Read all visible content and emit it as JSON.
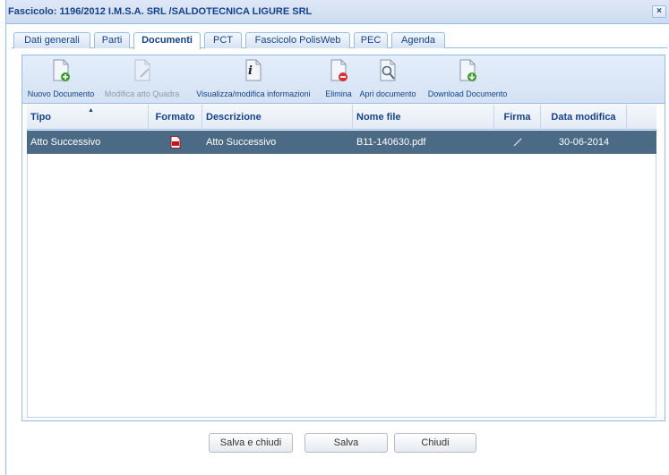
{
  "window": {
    "title": "Fascicolo: 1196/2012 I.M.S.A. SRL /SALDOTECNICA LIGURE SRL",
    "close_symbol": "×"
  },
  "tabs": [
    {
      "label": "Dati generali",
      "active": false
    },
    {
      "label": "Parti",
      "active": false
    },
    {
      "label": "Documenti",
      "active": true
    },
    {
      "label": "PCT",
      "active": false
    },
    {
      "label": "Fascicolo PolisWeb",
      "active": false
    },
    {
      "label": "PEC",
      "active": false
    },
    {
      "label": "Agenda",
      "active": false
    }
  ],
  "toolbar": {
    "buttons": [
      {
        "label": "Nuovo Documento",
        "icon": "new-document-icon",
        "enabled": true
      },
      {
        "label": "Modifica atto Quadra",
        "icon": "edit-document-icon",
        "enabled": false
      },
      {
        "label": "Visualizza/modifica informazioni",
        "icon": "info-icon",
        "enabled": true
      },
      {
        "label": "Elimina",
        "icon": "delete-document-icon",
        "enabled": true
      },
      {
        "label": "Apri documento",
        "icon": "open-document-icon",
        "enabled": true
      },
      {
        "label": "Download Documento",
        "icon": "download-document-icon",
        "enabled": true
      }
    ]
  },
  "grid": {
    "columns": [
      "Tipo",
      "Formato",
      "Descrizione",
      "Nome file",
      "Firma",
      "Data modifica"
    ],
    "sort_indicator": "▲",
    "rows": [
      {
        "tipo": "Atto Successivo",
        "formato": "pdf-icon",
        "descrizione": "Atto Successivo",
        "nome_file": "B11-140630.pdf",
        "firma": "signature-icon",
        "data_modifica": "30-06-2014"
      }
    ]
  },
  "footer": {
    "save_close_label": "Salva e chiudi",
    "save_label": "Salva",
    "close_label": "Chiudi"
  },
  "colors": {
    "accent": "#15428b",
    "selected_row": "#4a6a85",
    "border": "#99bbe8"
  }
}
